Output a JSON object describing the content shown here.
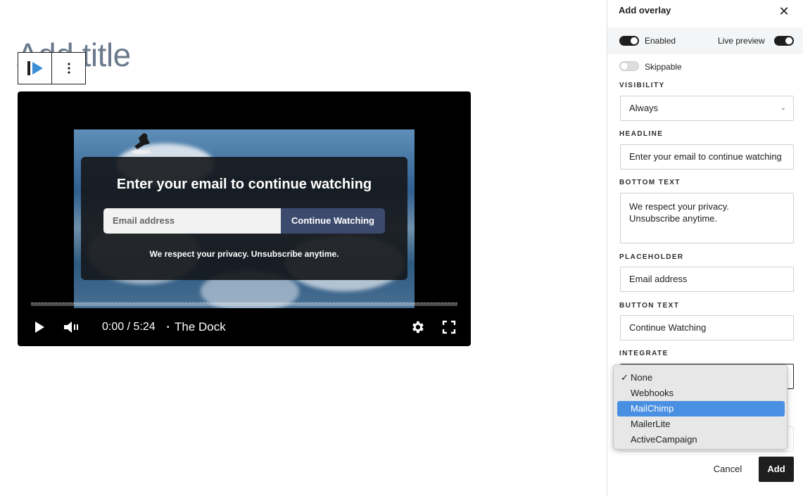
{
  "editor": {
    "title_placeholder": "Add title",
    "toolbar": {
      "block_icon": "video-overlay-block-icon",
      "more_icon": "vertical-dots-icon"
    }
  },
  "video": {
    "overlay": {
      "headline": "Enter your email to continue watching",
      "placeholder": "Email address",
      "button": "Continue Watching",
      "bottom_text": "We respect your privacy. Unsubscribe anytime."
    },
    "time": "0:00 / 5:24",
    "separator": "•",
    "title": "The Dock",
    "progress_fraction": 0
  },
  "panel": {
    "title": "Add overlay",
    "enabled_label": "Enabled",
    "live_preview_label": "Live preview",
    "skippable_label": "Skippable",
    "visibility": {
      "label": "VISIBILITY",
      "value": "Always"
    },
    "headline": {
      "label": "HEADLINE",
      "value": "Enter your email to continue watching"
    },
    "bottom_text": {
      "label": "BOTTOM TEXT",
      "line1": "We respect your privacy.",
      "line2": "Unsubscribe anytime."
    },
    "placeholder": {
      "label": "PLACEHOLDER",
      "value": "Email address"
    },
    "button_text": {
      "label": "BUTTON TEXT",
      "value": "Continue Watching"
    },
    "integrate": {
      "label": "INTEGRATE",
      "options": [
        "None",
        "Webhooks",
        "MailChimp",
        "MailerLite",
        "ActiveCampaign"
      ],
      "checked": "None",
      "highlighted": "MailChimp"
    },
    "cancel": "Cancel",
    "add": "Add",
    "states": {
      "enabled": true,
      "live_preview": true,
      "skippable": false
    }
  }
}
